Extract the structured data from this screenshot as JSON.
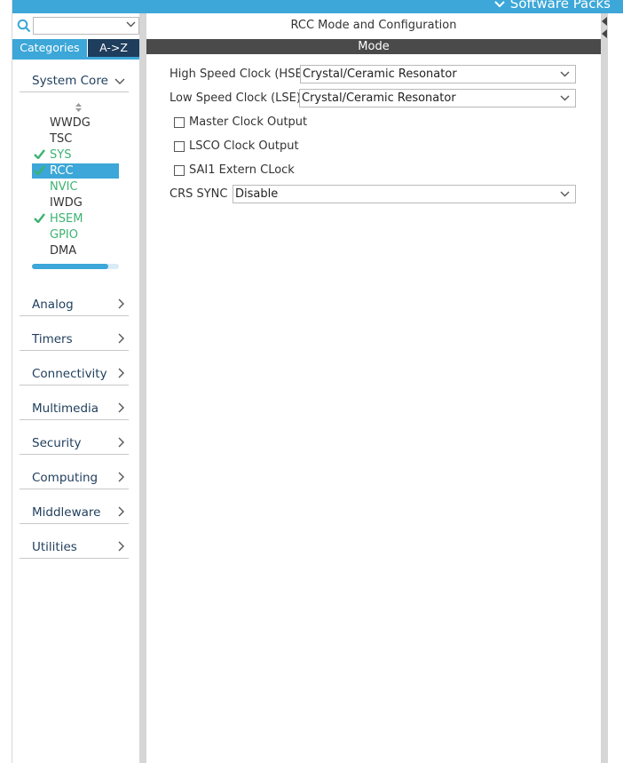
{
  "topbar": {
    "software_packs": "Software Packs"
  },
  "search": {
    "value": "",
    "placeholder": ""
  },
  "tabs": {
    "categories": "Categories",
    "az": "A->Z"
  },
  "categories": [
    {
      "label": "System Core",
      "expanded": true
    },
    {
      "label": "Analog"
    },
    {
      "label": "Timers"
    },
    {
      "label": "Connectivity"
    },
    {
      "label": "Multimedia"
    },
    {
      "label": "Security"
    },
    {
      "label": "Computing"
    },
    {
      "label": "Middleware"
    },
    {
      "label": "Utilities"
    }
  ],
  "system_core": {
    "peripherals": [
      {
        "name": "WWDG",
        "status": "none"
      },
      {
        "name": "TSC",
        "status": "none"
      },
      {
        "name": "SYS",
        "status": "checked"
      },
      {
        "name": "RCC",
        "status": "checked-selected"
      },
      {
        "name": "NVIC",
        "status": "green"
      },
      {
        "name": "IWDG",
        "status": "none"
      },
      {
        "name": "HSEM",
        "status": "checked"
      },
      {
        "name": "GPIO",
        "status": "green"
      },
      {
        "name": "DMA",
        "status": "none"
      }
    ],
    "scroll_progress": 0.88
  },
  "main": {
    "title": "RCC Mode and Configuration",
    "section": "Mode",
    "hse": {
      "label": "High Speed Clock (HSE)",
      "value": "Crystal/Ceramic Resonator"
    },
    "lse": {
      "label": "Low Speed Clock (LSE)",
      "value": "Crystal/Ceramic Resonator"
    },
    "checkboxes": [
      {
        "label": "Master Clock Output",
        "checked": false
      },
      {
        "label": "LSCO Clock Output",
        "checked": false
      },
      {
        "label": "SAI1 Extern CLock",
        "checked": false
      }
    ],
    "crs_sync": {
      "label": "CRS SYNC",
      "value": "Disable"
    }
  },
  "colors": {
    "accent": "#3ca7d8",
    "dark_tab": "#1f3d5c",
    "enabled_green": "#3cb371",
    "mode_header": "#4a4a4a"
  }
}
